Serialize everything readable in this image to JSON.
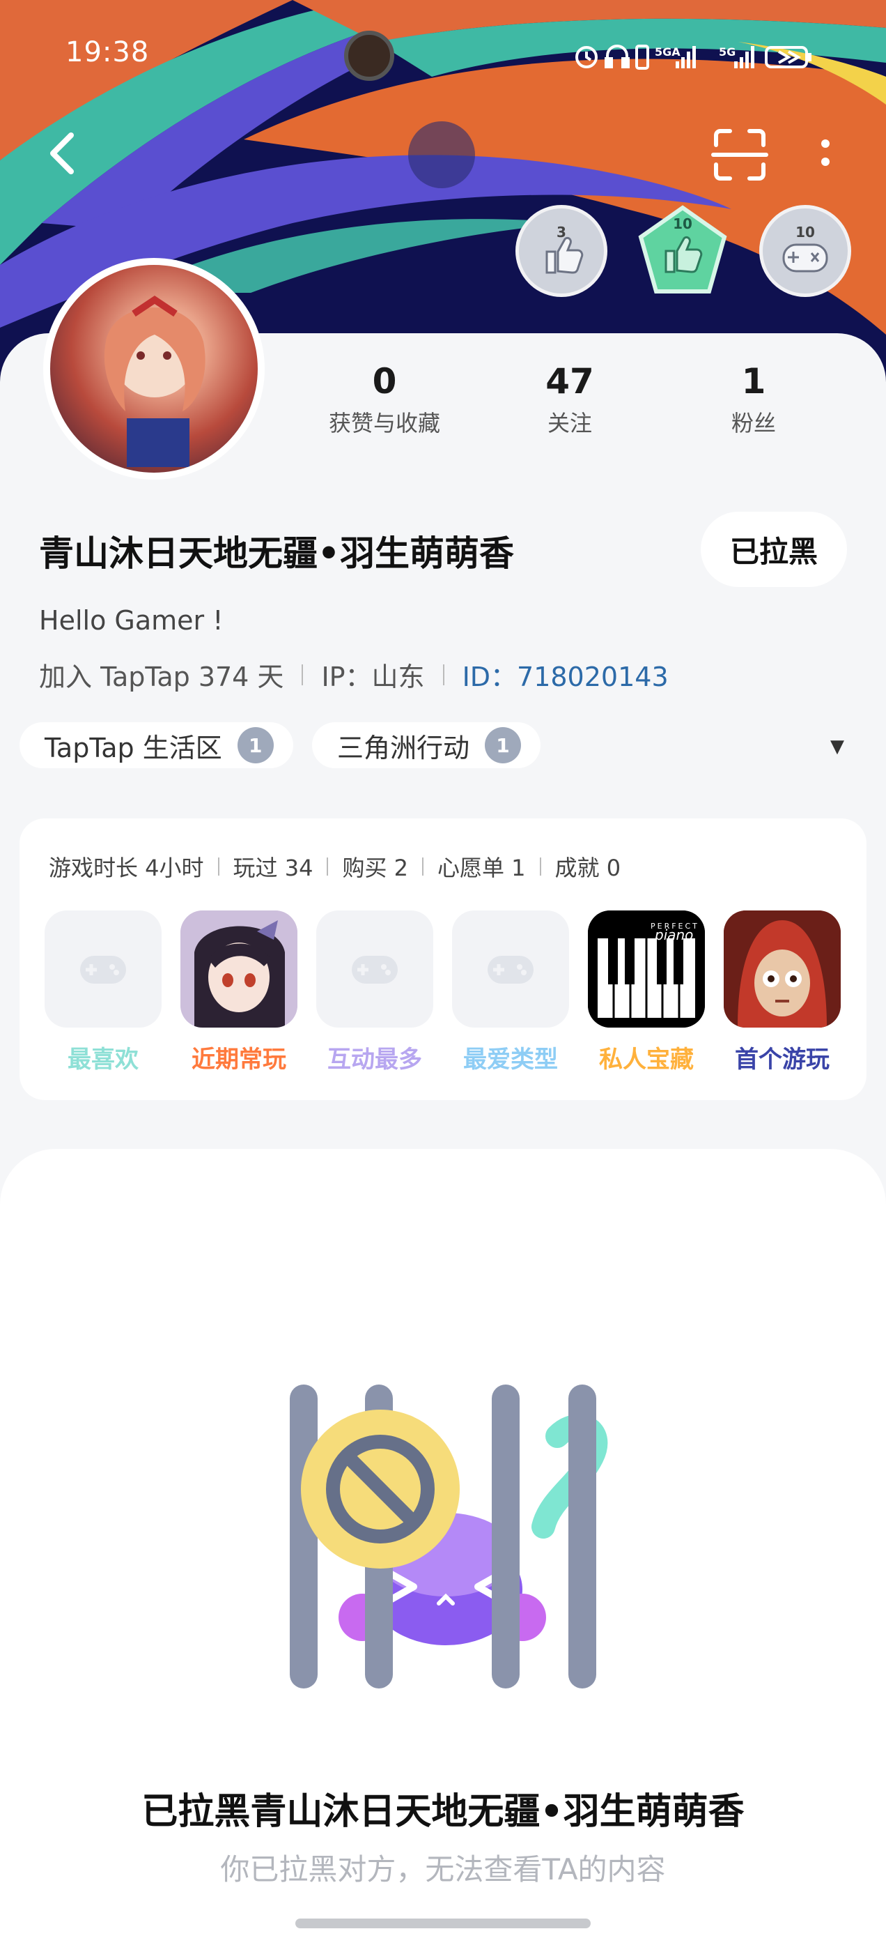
{
  "status_bar": {
    "time": "19:38",
    "network_1": "5GA",
    "network_2": "5G"
  },
  "header": {
    "back_icon": "chevron-left-icon",
    "scan_icon": "scan-icon",
    "more_icon": "more-vertical-icon",
    "badges": [
      {
        "count": "3",
        "icon": "thumbs-up-icon",
        "color": "#cfd3dc"
      },
      {
        "count": "10",
        "icon": "thumbs-up-icon",
        "color": "#5fd3a0"
      },
      {
        "count": "10",
        "icon": "gamepad-icon",
        "color": "#cfd3dc"
      }
    ]
  },
  "profile": {
    "stats": [
      {
        "value": "0",
        "label": "获赞与收藏"
      },
      {
        "value": "47",
        "label": "关注"
      },
      {
        "value": "1",
        "label": "粉丝"
      }
    ],
    "username": "青山沐日天地无疆•羽生萌萌香",
    "blocked_button": "已拉黑",
    "bio": "Hello Gamer !",
    "joined": "加入 TapTap 374 天",
    "ip": "IP：山东",
    "id": "ID：718020143",
    "chips": [
      {
        "label": "TapTap 生活区",
        "level": "1"
      },
      {
        "label": "三角洲行动",
        "level": "1"
      }
    ]
  },
  "games": {
    "stats": [
      "游戏时长 4小时",
      "玩过 34",
      "购买 2",
      "心愿单 1",
      "成就 0"
    ],
    "tiles": [
      {
        "label": "最喜欢",
        "color": "#8ee0d6",
        "icon": "gamepad-icon"
      },
      {
        "label": "近期常玩",
        "color": "#ff7a3d",
        "icon": "game-cover-anime"
      },
      {
        "label": "互动最多",
        "color": "#b7a6f0",
        "icon": "gamepad-icon"
      },
      {
        "label": "最爱类型",
        "color": "#8ecdf5",
        "icon": "gamepad-icon"
      },
      {
        "label": "私人宝藏",
        "color": "#ffb13c",
        "icon": "piano-app-icon"
      },
      {
        "label": "首个游玩",
        "color": "#3a44a8",
        "icon": "game-cover-red-hood"
      }
    ],
    "piano_brand_small": "PERFECT",
    "piano_brand": "piano"
  },
  "blocked": {
    "title": "已拉黑青山沐日天地无疆•羽生萌萌香",
    "subtitle": "你已拉黑对方，无法查看TA的内容"
  }
}
